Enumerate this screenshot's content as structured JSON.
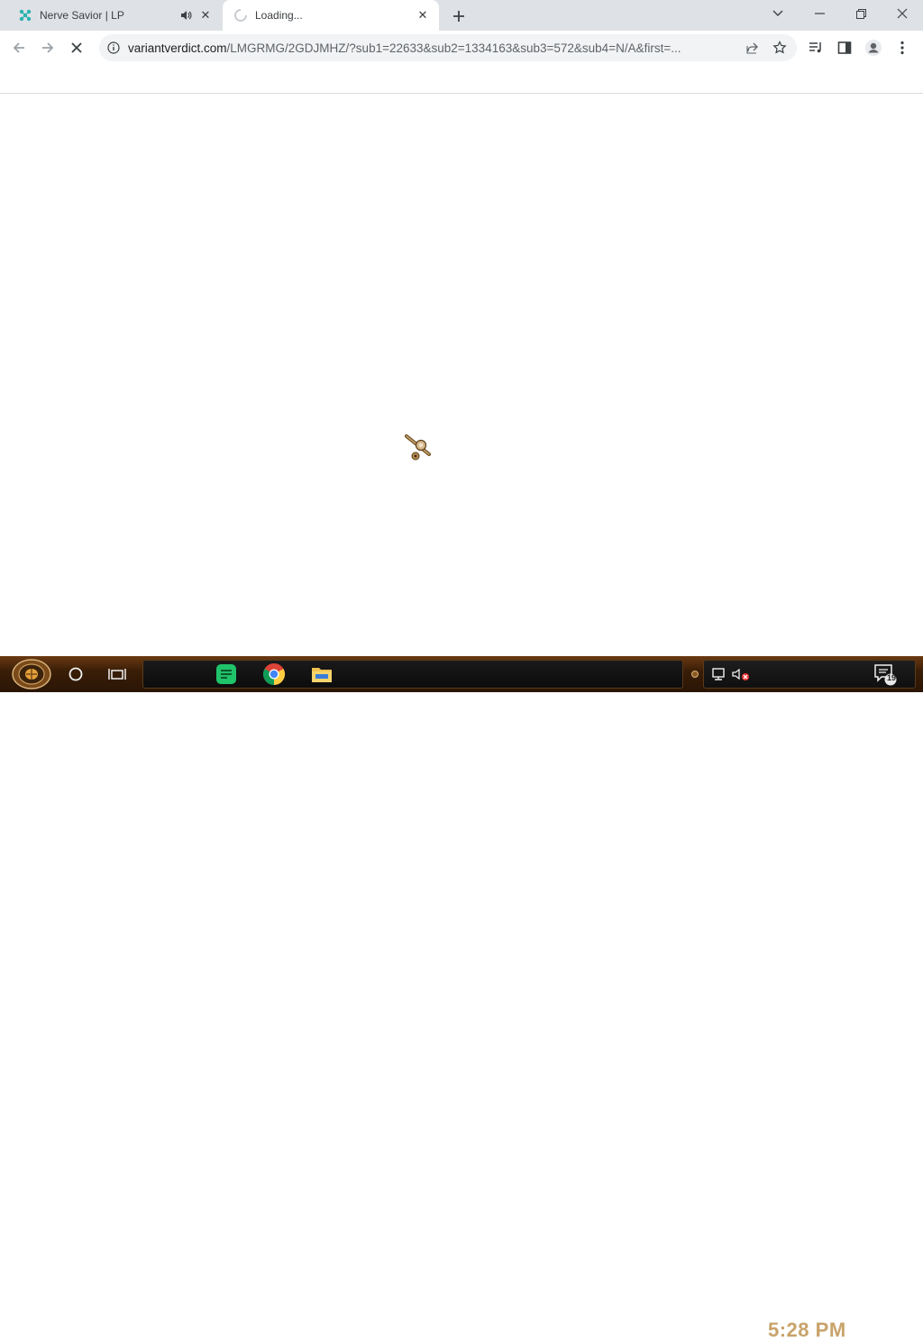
{
  "browser": {
    "tabs": [
      {
        "title": "Nerve Savior | LP",
        "icon": "nerve-savior-favicon",
        "audio": true,
        "active": false
      },
      {
        "title": "Loading...",
        "icon": "loading-spinner-icon",
        "audio": false,
        "active": true
      }
    ],
    "omnibox": {
      "host": "variantverdict.com",
      "path": "/LMGRMG/2GDJMHZ/?sub1=22633&sub2=1334163&sub3=572&sub4=N/A&first=..."
    }
  },
  "taskbar": {
    "clock": "5:28 PM",
    "notification_count": "19"
  },
  "colors": {
    "tabstrip": "#dee1e6",
    "omnibox_bg": "#f1f3f4",
    "taskbar_brown": "#3a1e07",
    "clock_gold": "#c8a36a"
  }
}
